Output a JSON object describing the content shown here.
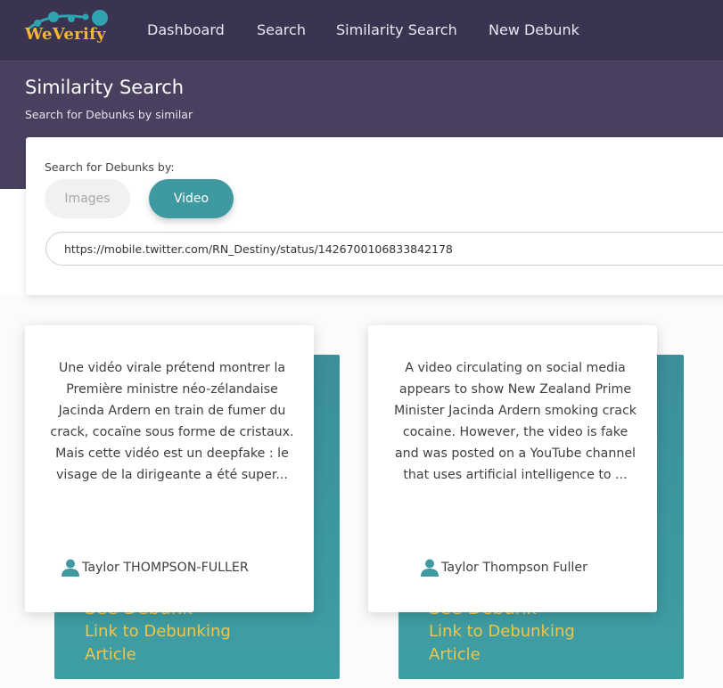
{
  "brand": {
    "name": "WeVerify"
  },
  "nav": {
    "items": [
      {
        "label": "Dashboard"
      },
      {
        "label": "Search"
      },
      {
        "label": "Similarity Search"
      },
      {
        "label": "New Debunk"
      }
    ]
  },
  "header": {
    "title": "Similarity Search",
    "subtitle": "Search for Debunks by similar"
  },
  "search": {
    "label": "Search for Debunks by:",
    "options": [
      {
        "label": "Images",
        "selected": false
      },
      {
        "label": "Video",
        "selected": true
      }
    ],
    "url_value": "https://mobile.twitter.com/RN_Destiny/status/1426700106833842178"
  },
  "results": [
    {
      "summary": "Une vidéo virale prétend montrer la Première ministre néo-zélandaise Jacinda Ardern en train de fumer du crack, cocaïne sous forme de cristaux. Mais cette vidéo est un deepfake : le visage de la dirigeante a été super...",
      "author": "Taylor THOMPSON-FULLER",
      "back_title": "See Debunk",
      "back_link": "Link to Debunking Article"
    },
    {
      "summary": "A video circulating on social media appears to show New Zealand Prime Minister Jacinda Ardern smoking crack cocaine. However, the video is fake and was posted on a YouTube channel that uses artificial intelligence to ...",
      "author": "Taylor Thompson Fuller",
      "back_title": "See Debunk",
      "back_link": "Link to Debunking Article"
    }
  ],
  "colors": {
    "topbar": "#3a3450",
    "header": "#48405e",
    "accent_teal": "#3e99a0",
    "link_yellow": "#f0c548",
    "brand_yellow": "#f2b632",
    "icon_teal": "#3e99a0"
  },
  "icons": {
    "logo": "weverify-logo",
    "author": "user-icon"
  }
}
